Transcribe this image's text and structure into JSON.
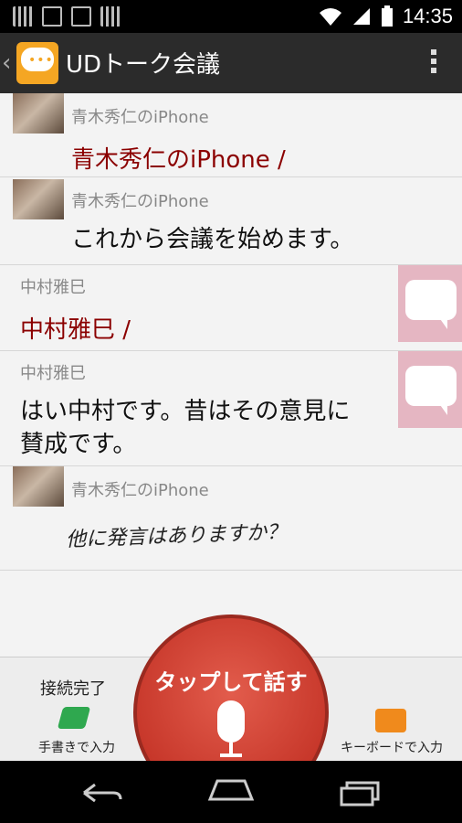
{
  "status_bar": {
    "time": "14:35"
  },
  "action_bar": {
    "title": "UDトーク会議"
  },
  "messages": [
    {
      "sender": "青木秀仁のiPhone",
      "text": "青木秀仁のiPhone /"
    },
    {
      "sender": "青木秀仁のiPhone",
      "text": "これから会議を始めます。"
    },
    {
      "sender": "中村雅巳",
      "text": "中村雅巳 /"
    },
    {
      "sender": "中村雅巳",
      "text_line1": "はい中村です。昔はその意見に",
      "text_line2": "賛成です。"
    },
    {
      "sender": "青木秀仁のiPhone",
      "handwriting": "他に発言はありますか？"
    }
  ],
  "bottom_bar": {
    "connection_status": "接続完了",
    "talk_button_label": "タップして話す",
    "handwriting_label": "手書きで入力",
    "keyboard_label": "キーボードで入力"
  }
}
